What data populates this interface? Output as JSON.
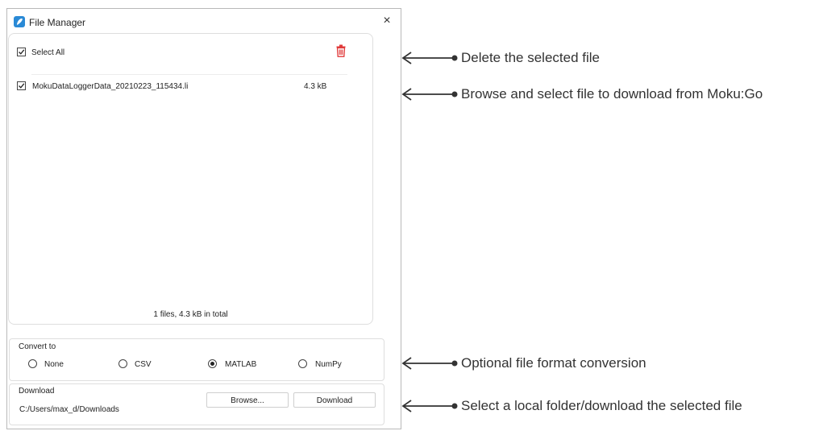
{
  "window": {
    "title": "File Manager",
    "close_label": "×"
  },
  "file_panel": {
    "select_all_label": "Select All",
    "select_all_checked": true,
    "files": [
      {
        "name": "MokuDataLoggerData_20210223_115434.li",
        "size": "4.3 kB",
        "checked": true
      }
    ],
    "summary": "1 files, 4.3 kB in total"
  },
  "convert": {
    "label": "Convert to",
    "options": [
      "None",
      "CSV",
      "MATLAB",
      "NumPy"
    ],
    "selected": "MATLAB"
  },
  "download": {
    "label": "Download",
    "path": "C:/Users/max_d/Downloads",
    "browse_label": "Browse...",
    "download_label": "Download"
  },
  "annotations": [
    "Delete the selected file",
    "Browse and select file to download from Moku:Go",
    "Optional file format conversion",
    "Select a local folder/download the selected file"
  ],
  "colors": {
    "accent": "#2a8ad6",
    "delete": "#e03a3a",
    "annotation_text": "#333333"
  }
}
